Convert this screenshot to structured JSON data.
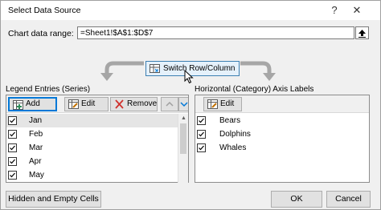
{
  "window": {
    "title": "Select Data Source",
    "help_glyph": "?",
    "close_glyph": "✕"
  },
  "range": {
    "label": "Chart data range:",
    "value": "=Sheet1!$A$1:$D$7"
  },
  "switch_button": {
    "label": "Switch Row/Column"
  },
  "legend_panel": {
    "title": "Legend Entries (Series)",
    "add_label": "Add",
    "edit_label": "Edit",
    "remove_label": "Remove",
    "items": [
      {
        "label": "Jan",
        "checked": true,
        "selected": true
      },
      {
        "label": "Feb",
        "checked": true,
        "selected": false
      },
      {
        "label": "Mar",
        "checked": true,
        "selected": false
      },
      {
        "label": "Apr",
        "checked": true,
        "selected": false
      },
      {
        "label": "May",
        "checked": true,
        "selected": false
      }
    ]
  },
  "axis_panel": {
    "title": "Horizontal (Category) Axis Labels",
    "edit_label": "Edit",
    "items": [
      {
        "label": "Bears",
        "checked": true
      },
      {
        "label": "Dolphins",
        "checked": true
      },
      {
        "label": "Whales",
        "checked": true
      }
    ]
  },
  "buttons": {
    "hidden_empty": "Hidden and Empty Cells",
    "ok": "OK",
    "cancel": "Cancel"
  },
  "colors": {
    "accent": "#0078d7",
    "remove_red": "#d0312d"
  }
}
